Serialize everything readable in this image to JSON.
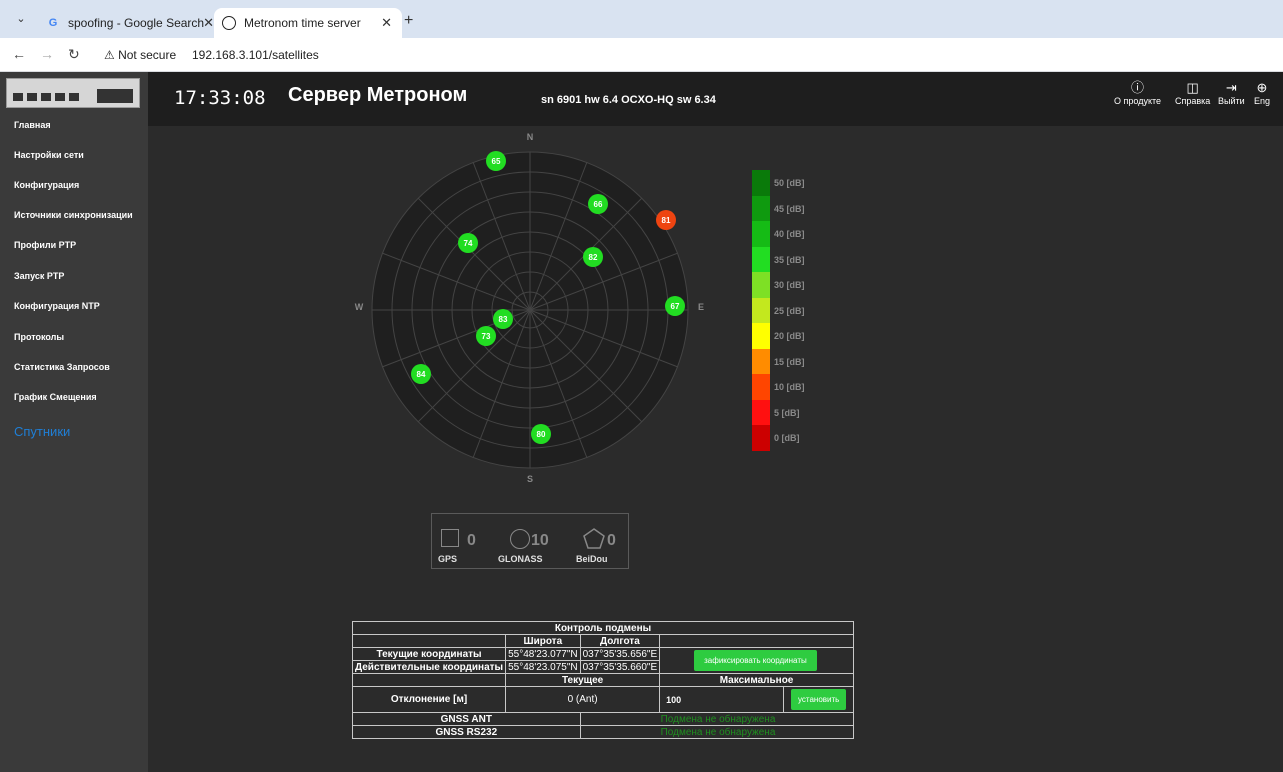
{
  "browser": {
    "tabs": [
      {
        "title": "spoofing - Google Search",
        "favicon": "google-icon"
      },
      {
        "title": "Metronom time server",
        "favicon": "clock-icon"
      }
    ],
    "security_label": "Not secure",
    "url": "192.168.3.101/satellites"
  },
  "header": {
    "clock": "17:33:08",
    "title": "Сервер Метроном",
    "serial": "sn 6901 hw 6.4 OCXO-HQ sw 6.34",
    "buttons": [
      {
        "label": "О продукте",
        "icon": "info-icon"
      },
      {
        "label": "Справка",
        "icon": "book-icon"
      },
      {
        "label": "Выйти",
        "icon": "logout-icon"
      },
      {
        "label": "Eng",
        "icon": "globe-icon"
      }
    ]
  },
  "sidebar": {
    "items": [
      {
        "label": "Главная"
      },
      {
        "label": "Настройки сети"
      },
      {
        "label": "Конфигурация"
      },
      {
        "label": "Источники синхронизации"
      },
      {
        "label": "Профили PTP"
      },
      {
        "label": "Запуск PTP"
      },
      {
        "label": "Конфигурация NTP"
      },
      {
        "label": "Протоколы"
      },
      {
        "label": "Статистика Запросов"
      },
      {
        "label": "График Смещения"
      },
      {
        "label": "Спутники",
        "active": true
      }
    ]
  },
  "skyplot": {
    "compass": {
      "n": "N",
      "s": "S",
      "e": "E",
      "w": "W"
    },
    "satellites": [
      {
        "id": "65",
        "color": "#22dd22"
      },
      {
        "id": "66",
        "color": "#22dd22"
      },
      {
        "id": "81",
        "color": "#ee4411"
      },
      {
        "id": "74",
        "color": "#22dd22"
      },
      {
        "id": "82",
        "color": "#22dd22"
      },
      {
        "id": "67",
        "color": "#22dd22"
      },
      {
        "id": "83",
        "color": "#22dd22"
      },
      {
        "id": "73",
        "color": "#22dd22"
      },
      {
        "id": "84",
        "color": "#22dd22"
      },
      {
        "id": "80",
        "color": "#22dd22"
      }
    ],
    "scale": [
      {
        "label": "50 [dB]",
        "color": "#0a7a0a"
      },
      {
        "label": "45 [dB]",
        "color": "#0f9a0f"
      },
      {
        "label": "40 [dB]",
        "color": "#15bb15"
      },
      {
        "label": "35 [dB]",
        "color": "#22dd22"
      },
      {
        "label": "30 [dB]",
        "color": "#7ee025"
      },
      {
        "label": "25 [dB]",
        "color": "#c3e81e"
      },
      {
        "label": "20 [dB]",
        "color": "#ffff00"
      },
      {
        "label": "15 [dB]",
        "color": "#ff8c00"
      },
      {
        "label": "10 [dB]",
        "color": "#ff4500"
      },
      {
        "label": "5 [dB]",
        "color": "#ff1010"
      },
      {
        "label": "0 [dB]",
        "color": "#cc0000"
      }
    ]
  },
  "gnss_summary": {
    "gps": {
      "name": "GPS",
      "count": "0"
    },
    "glonass": {
      "name": "GLONASS",
      "count": "10"
    },
    "beidou": {
      "name": "BeiDou",
      "count": "0"
    }
  },
  "spoofing": {
    "title": "Контроль подмены",
    "col_lat": "Широта",
    "col_lon": "Долгота",
    "current_label": "Текущие координаты",
    "current_lat": "55°48'23.077\"N",
    "current_lon": "037°35'35.656\"E",
    "actual_label": "Действительные координаты",
    "actual_lat": "55°48'23.075\"N",
    "actual_lon": "037°35'35.660\"E",
    "fix_button": "зафиксировать координаты",
    "col_current": "Текущее",
    "col_max": "Максимальное",
    "deviation_label": "Отклонение [м]",
    "deviation_current": "0 (Ant)",
    "deviation_max": "100",
    "set_button": "установить",
    "ant_label": "GNSS ANT",
    "ant_status": "Подмена не обнаружена",
    "rs232_label": "GNSS RS232",
    "rs232_status": "Подмена не обнаружена"
  }
}
